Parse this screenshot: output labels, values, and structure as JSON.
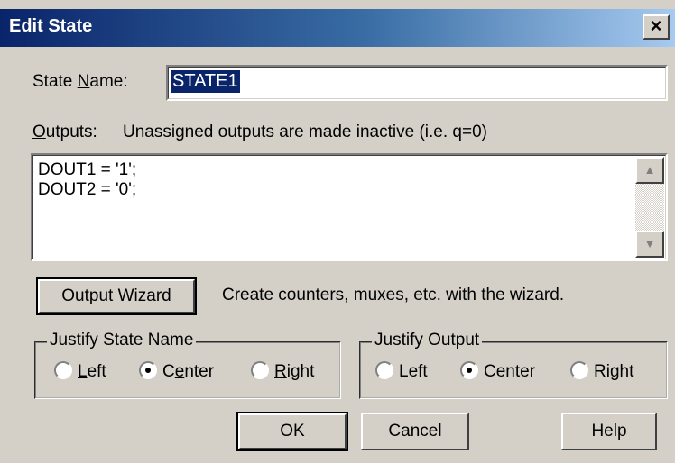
{
  "window": {
    "title": "Edit State",
    "close_glyph": "×"
  },
  "state_name": {
    "label_pre": "State ",
    "label_key": "N",
    "label_post": "ame:",
    "value": "STATE1"
  },
  "outputs": {
    "label_key": "O",
    "label_post": "utputs:",
    "hint": "Unassigned outputs are made inactive (i.e. q=0)",
    "lines": [
      "DOUT1 = '1';",
      "DOUT2 = '0';"
    ]
  },
  "wizard": {
    "button_label": "Output Wizard",
    "description": "Create counters, muxes, etc. with the wizard."
  },
  "justify_state": {
    "title": "Justify State Name",
    "options": [
      {
        "pre": "",
        "key": "L",
        "post": "eft",
        "selected": false
      },
      {
        "pre": "C",
        "key": "e",
        "post": "nter",
        "selected": true
      },
      {
        "pre": "",
        "key": "R",
        "post": "ight",
        "selected": false
      }
    ]
  },
  "justify_output": {
    "title": "Justify Output",
    "options": [
      {
        "label": "Left",
        "selected": false
      },
      {
        "label": "Center",
        "selected": true
      },
      {
        "label": "Right",
        "selected": false
      }
    ]
  },
  "buttons": {
    "ok": "OK",
    "cancel": "Cancel",
    "help": "Help"
  }
}
